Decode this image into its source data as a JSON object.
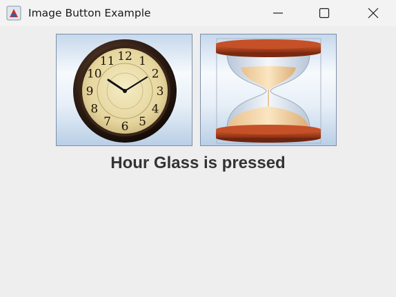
{
  "window": {
    "title": "Image Button Example",
    "controls": [
      "minimize",
      "maximize",
      "close"
    ]
  },
  "buttons": [
    {
      "name": "Clock",
      "icon": "clock-image"
    },
    {
      "name": "Hour Glass",
      "icon": "hourglass-image"
    }
  ],
  "clock": {
    "numerals": [
      "12",
      "1",
      "2",
      "3",
      "4",
      "5",
      "6",
      "7",
      "8",
      "9",
      "10",
      "11"
    ]
  },
  "status": {
    "text": "Hour Glass is pressed"
  }
}
